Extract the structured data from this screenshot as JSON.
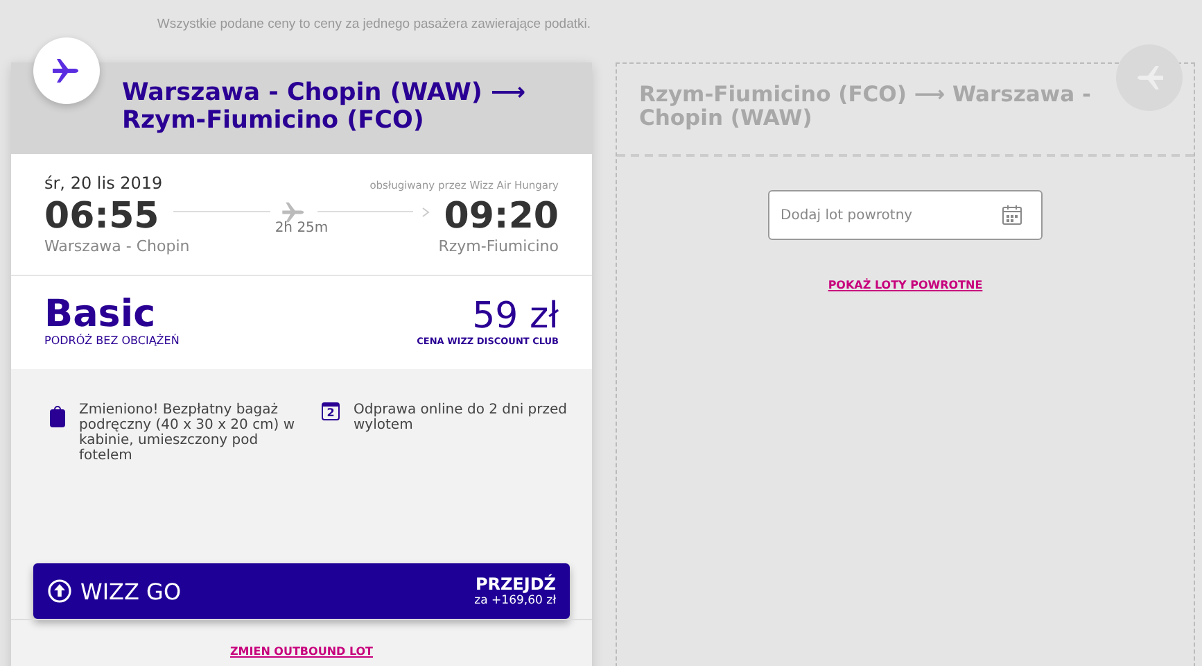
{
  "note": "Wszystkie podane ceny to ceny za jednego pasażera zawierające podatki.",
  "outbound": {
    "route": "Warszawa - Chopin (WAW) ⟶ Rzym-Fiumicino (FCO)",
    "date": "śr, 20 lis 2019",
    "operator": "obsługiwany przez Wizz Air Hungary",
    "depart_time": "06:55",
    "depart_airport": "Warszawa - Chopin",
    "duration": "2h 25m",
    "arrive_time": "09:20",
    "arrive_airport": "Rzym-Fiumicino",
    "fare": {
      "name": "Basic",
      "subtitle": "PODRÓŻ BEZ OBCIĄŻEŃ",
      "price": "59 zł",
      "price_note": "CENA WIZZ DISCOUNT CLUB"
    },
    "features": [
      {
        "kind": "bag",
        "text": "Zmieniono! Bezpłatny bagaż podręczny (40 x 30 x 20 cm) w kabinie, umieszczony pod fotelem"
      },
      {
        "kind": "calendar",
        "icon_text": "2",
        "text": "Odprawa online do 2 dni przed wylotem"
      }
    ],
    "upgrade": {
      "label": "WIZZ GO",
      "action": "PRZEJDŹ",
      "extra": "za +169,60 zł"
    },
    "change_link": "ZMIEN OUTBOUND LOT"
  },
  "return": {
    "route": "Rzym-Fiumicino (FCO) ⟶ Warszawa - Chopin (WAW)",
    "date_field": {
      "placeholder": "Dodaj lot powrotny"
    },
    "link": "POKAŻ LOTY POWROTNE"
  }
}
